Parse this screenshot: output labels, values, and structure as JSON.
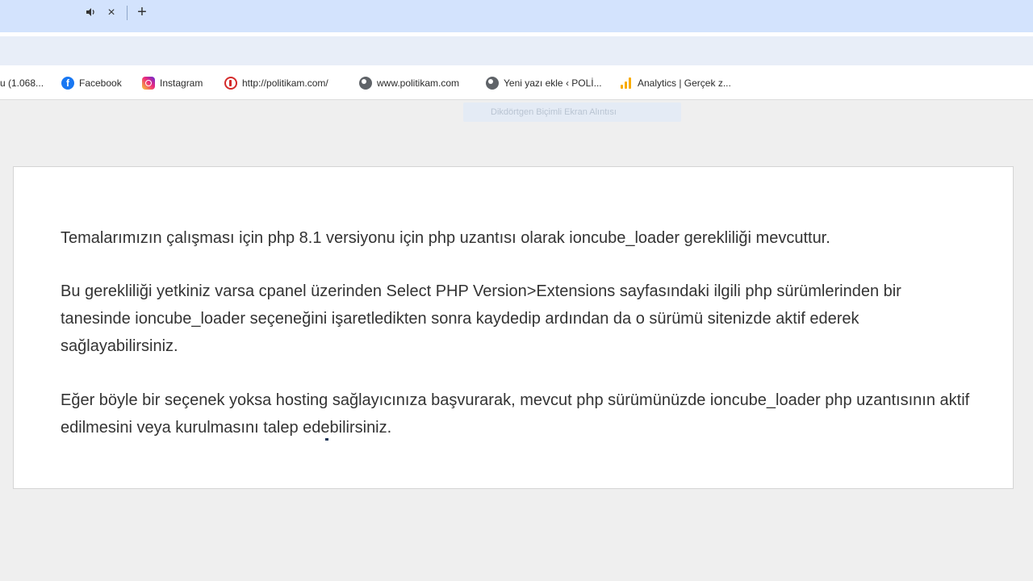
{
  "tabstrip": {
    "audio_icon": "speaker-icon",
    "close_icon": "close-icon",
    "close_glyph": "×",
    "new_tab_icon": "plus-icon",
    "new_tab_glyph": "+"
  },
  "bookmarks": [
    {
      "label": "u (1.068...",
      "icon": "none"
    },
    {
      "label": "Facebook",
      "icon": "facebook-icon"
    },
    {
      "label": "Instagram",
      "icon": "instagram-icon"
    },
    {
      "label": "http://politikam.com/",
      "icon": "politikam-icon"
    },
    {
      "label": "www.politikam.com",
      "icon": "globe-icon"
    },
    {
      "label": "Yeni yazı ekle ‹ POLİ...",
      "icon": "globe-icon"
    },
    {
      "label": "Analytics | Gerçek z...",
      "icon": "analytics-icon"
    }
  ],
  "tooltip": {
    "text": "Dikdörtgen Biçimli Ekran Alıntısı"
  },
  "content": {
    "paragraphs": [
      "Temalarımızın çalışması için php 8.1 versiyonu için php uzantısı olarak ioncube_loader gerekliliği mevcuttur.",
      "Bu gerekliliği yetkiniz varsa cpanel üzerinden Select PHP Version>Extensions sayfasındaki ilgili php sürümlerinden bir tanesinde ioncube_loader seçeneğini işaretledikten sonra kaydedip ardından da o sürümü sitenizde aktif ederek sağlayabilirsiniz.",
      "Eğer böyle bir seçenek yoksa hosting sağlayıcınıza başvurarak, mevcut php sürümünüzde ioncube_loader php uzantısının aktif edilmesini veya kurulmasını talep edebilirsiniz."
    ]
  },
  "colors": {
    "tabstrip_bg": "#d3e3fd",
    "page_bg": "#efefef",
    "text": "#333333"
  }
}
